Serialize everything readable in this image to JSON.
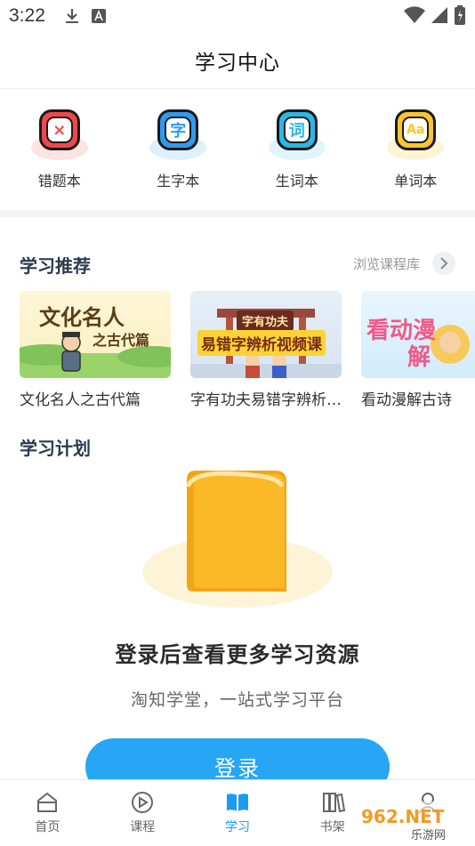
{
  "status_bar": {
    "time": "3:22"
  },
  "header": {
    "title": "学习中心"
  },
  "tools": [
    {
      "label": "错题本",
      "icon": "wrong-questions-icon",
      "glyph": "×",
      "color": "#f0484a",
      "shadow": "#fde3e3"
    },
    {
      "label": "生字本",
      "icon": "new-characters-icon",
      "glyph": "字",
      "color": "#2d9cf0",
      "shadow": "#dff0fd"
    },
    {
      "label": "生词本",
      "icon": "new-words-icon",
      "glyph": "词",
      "color": "#2ab8e8",
      "shadow": "#dff4fb"
    },
    {
      "label": "单词本",
      "icon": "vocabulary-icon",
      "glyph": "Aa",
      "color": "#fcc52e",
      "shadow": "#fdf4d5"
    }
  ],
  "recommend": {
    "title": "学习推荐",
    "browse_label": "浏览课程库",
    "courses": [
      {
        "name": "文化名人之古代篇",
        "thumb_text": "文化名人",
        "thumb_sub": "之古代篇"
      },
      {
        "name": "字有功夫易错字辨析视频课",
        "thumb_text": "字有功夫",
        "thumb_sub": "易错字辨析视频课"
      },
      {
        "name": "看动漫解古诗",
        "thumb_text": "看动漫",
        "thumb_sub": "解"
      }
    ]
  },
  "plan": {
    "title": "学习计划",
    "empty_title": "登录后查看更多学习资源",
    "empty_subtitle": "淘知学堂，一站式学习平台",
    "login_label": "登录"
  },
  "bottom_nav": [
    {
      "label": "首页",
      "icon": "home-icon",
      "active": false
    },
    {
      "label": "课程",
      "icon": "course-play-icon",
      "active": false
    },
    {
      "label": "学习",
      "icon": "study-book-icon",
      "active": true
    },
    {
      "label": "书架",
      "icon": "bookshelf-icon",
      "active": false
    },
    {
      "label": "",
      "icon": "profile-icon",
      "active": false
    }
  ],
  "watermark": {
    "text": "962.NET",
    "sub": "乐游网"
  },
  "colors": {
    "accent": "#1e9bf0",
    "button": "#27a6f5",
    "book": "#fbb928"
  }
}
